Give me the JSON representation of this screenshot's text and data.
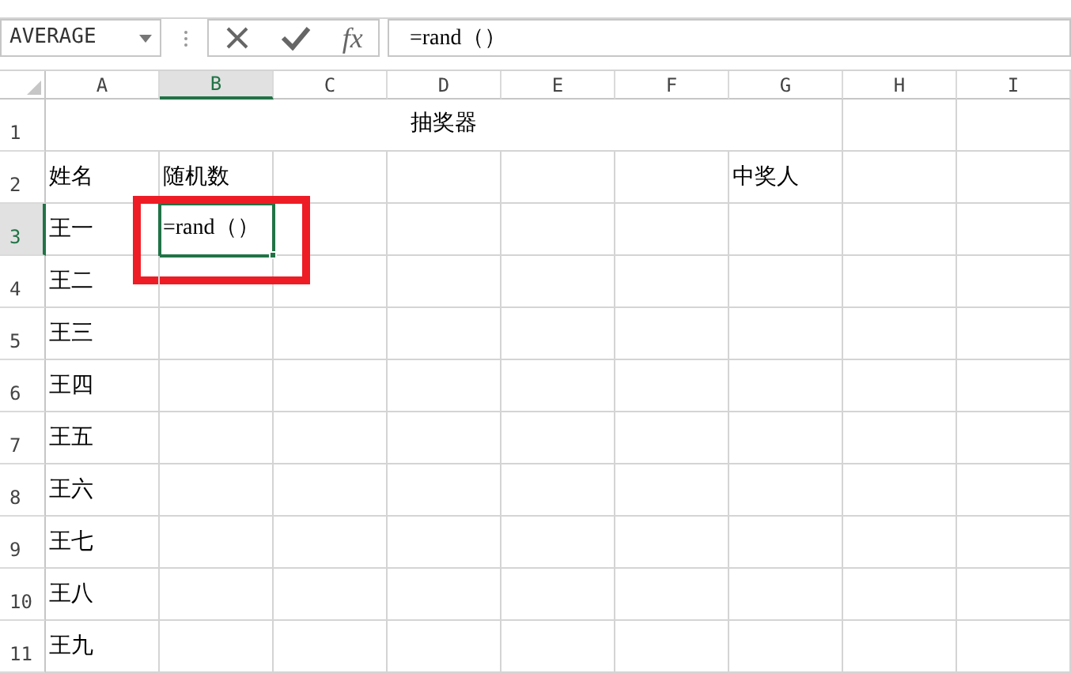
{
  "name_box": {
    "value": "AVERAGE"
  },
  "formula_bar": {
    "function_label": "fx",
    "value": "=rand（）"
  },
  "columns": [
    {
      "label": "A",
      "selected": false
    },
    {
      "label": "B",
      "selected": true
    },
    {
      "label": "C",
      "selected": false
    },
    {
      "label": "D",
      "selected": false
    },
    {
      "label": "E",
      "selected": false
    },
    {
      "label": "F",
      "selected": false
    },
    {
      "label": "G",
      "selected": false
    },
    {
      "label": "H",
      "selected": false
    },
    {
      "label": "I",
      "selected": false
    }
  ],
  "rows": [
    {
      "number": "1",
      "selected": false,
      "kind": "title",
      "title": "抽奖器"
    },
    {
      "number": "2",
      "selected": false,
      "kind": "data",
      "cells": [
        {
          "text": "姓名"
        },
        {
          "text": "随机数"
        },
        null,
        null,
        null,
        null,
        {
          "text": "中奖人"
        },
        null,
        null
      ]
    },
    {
      "number": "3",
      "selected": true,
      "kind": "data",
      "cells": [
        {
          "text": "王一"
        },
        {
          "text": "=rand（）",
          "active": true,
          "highlighted": true
        },
        null,
        null,
        null,
        null,
        null,
        null,
        null
      ]
    },
    {
      "number": "4",
      "selected": false,
      "kind": "data",
      "cells": [
        {
          "text": "王二"
        },
        null,
        null,
        null,
        null,
        null,
        null,
        null,
        null
      ]
    },
    {
      "number": "5",
      "selected": false,
      "kind": "data",
      "cells": [
        {
          "text": "王三"
        },
        null,
        null,
        null,
        null,
        null,
        null,
        null,
        null
      ]
    },
    {
      "number": "6",
      "selected": false,
      "kind": "data",
      "cells": [
        {
          "text": "王四"
        },
        null,
        null,
        null,
        null,
        null,
        null,
        null,
        null
      ]
    },
    {
      "number": "7",
      "selected": false,
      "kind": "data",
      "cells": [
        {
          "text": "王五"
        },
        null,
        null,
        null,
        null,
        null,
        null,
        null,
        null
      ]
    },
    {
      "number": "8",
      "selected": false,
      "kind": "data",
      "cells": [
        {
          "text": "王六"
        },
        null,
        null,
        null,
        null,
        null,
        null,
        null,
        null
      ]
    },
    {
      "number": "9",
      "selected": false,
      "kind": "data",
      "cells": [
        {
          "text": "王七"
        },
        null,
        null,
        null,
        null,
        null,
        null,
        null,
        null
      ]
    },
    {
      "number": "10",
      "selected": false,
      "kind": "data",
      "cells": [
        {
          "text": "王八"
        },
        null,
        null,
        null,
        null,
        null,
        null,
        null,
        null
      ]
    },
    {
      "number": "11",
      "selected": false,
      "kind": "data",
      "cells": [
        {
          "text": "王九"
        },
        null,
        null,
        null,
        null,
        null,
        null,
        null,
        null
      ]
    }
  ]
}
